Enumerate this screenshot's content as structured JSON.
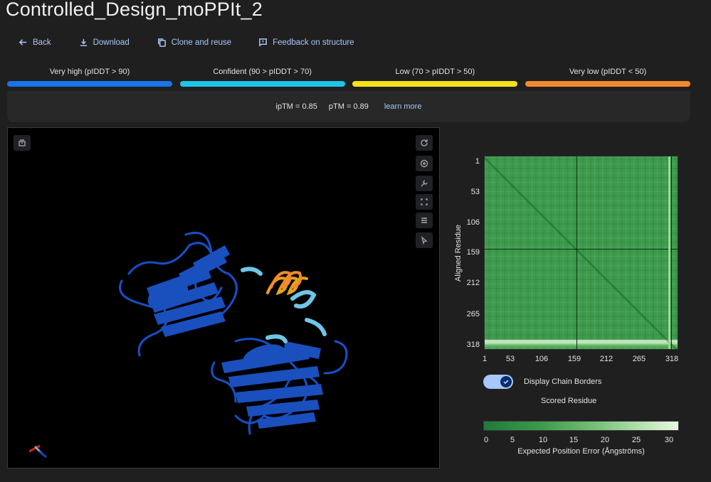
{
  "title": "Controlled_Design_moPPIt_2",
  "actions": {
    "back": "Back",
    "download": "Download",
    "clone": "Clone and reuse",
    "feedback": "Feedback on structure"
  },
  "legend": [
    {
      "label": "Very high (pIDDT > 90)",
      "color": "#1a73e8"
    },
    {
      "label": "Confident (90 > pIDDT > 70)",
      "color": "#1ec4e6"
    },
    {
      "label": "Low (70 > pIDDT > 50)",
      "color": "#f5e11a"
    },
    {
      "label": "Very low (pIDDT < 50)",
      "color": "#f08a2c"
    }
  ],
  "scores": {
    "iptm": "ipTM = 0.85",
    "ptm": "pTM = 0.89",
    "learn_more": "learn more"
  },
  "viewer_icons": [
    "layers-icon",
    "reset-view-icon",
    "style-icon",
    "tools-icon",
    "fullscreen-icon",
    "settings-icon",
    "select-icon"
  ],
  "pae": {
    "y_ticks": [
      "1",
      "53",
      "106",
      "159",
      "212",
      "265",
      "318"
    ],
    "x_ticks": [
      "1",
      "53",
      "106",
      "159",
      "212",
      "265",
      "318"
    ],
    "ylabel": "Aligned Residue",
    "xlabel": "Scored Residue",
    "toggle_label": "Display Chain Borders",
    "toggle_on": true,
    "colorbar_ticks": [
      "0",
      "5",
      "10",
      "15",
      "20",
      "25",
      "30"
    ],
    "colorbar_label": "Expected Position Error (Ångströms)"
  }
}
